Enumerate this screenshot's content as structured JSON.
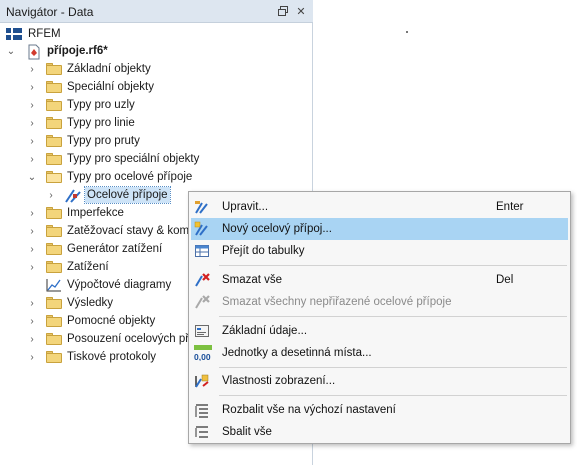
{
  "navigator": {
    "title": "Navigátor - Data",
    "root_label": "RFEM",
    "project_label": "přípoje.rf6*"
  },
  "tree_items": [
    {
      "label": "Základní objekty"
    },
    {
      "label": "Speciální objekty"
    },
    {
      "label": "Typy pro uzly"
    },
    {
      "label": "Typy pro linie"
    },
    {
      "label": "Typy pro pruty"
    },
    {
      "label": "Typy pro speciální objekty"
    },
    {
      "label": "Typy pro ocelové přípoje"
    },
    {
      "label": "Ocelové přípoje"
    },
    {
      "label": "Imperfekce"
    },
    {
      "label": "Zatěžovací stavy & kombinace"
    },
    {
      "label": "Generátor zatížení"
    },
    {
      "label": "Zatížení"
    },
    {
      "label": "Výpočtové diagramy"
    },
    {
      "label": "Výsledky"
    },
    {
      "label": "Pomocné objekty"
    },
    {
      "label": "Posouzení ocelových přípojů"
    },
    {
      "label": "Tiskové protokoly"
    }
  ],
  "context_menu": {
    "items": [
      {
        "label": "Upravit...",
        "shortcut": "Enter"
      },
      {
        "label": "Nový ocelový přípoj...",
        "shortcut": ""
      },
      {
        "label": "Přejít do tabulky",
        "shortcut": ""
      },
      {
        "label": "Smazat vše",
        "shortcut": "Del"
      },
      {
        "label": "Smazat všechny nepřiřazené ocelové přípoje",
        "shortcut": ""
      },
      {
        "label": "Základní údaje...",
        "shortcut": ""
      },
      {
        "label": "Jednotky a desetinná místa...",
        "shortcut": ""
      },
      {
        "label": "Vlastnosti zobrazení...",
        "shortcut": ""
      },
      {
        "label": "Rozbalit vše na výchozí nastavení",
        "shortcut": ""
      },
      {
        "label": "Sbalit vše",
        "shortcut": ""
      }
    ],
    "units_icon_text": "0,00"
  },
  "colors": {
    "header_bg": "#dde6f0",
    "highlight": "#a9d4f3",
    "selection": "#cde3f7",
    "folder": "#f3d57b"
  }
}
